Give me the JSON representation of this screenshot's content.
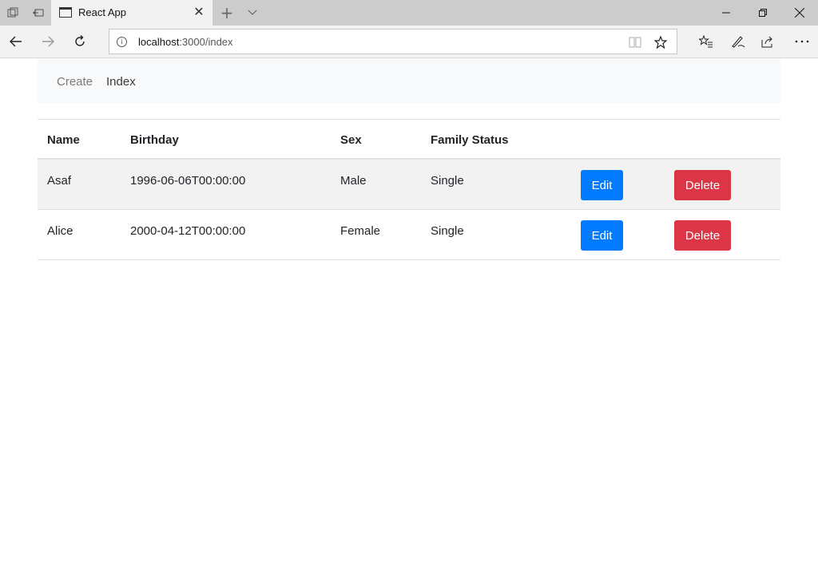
{
  "browser": {
    "tab_title": "React App",
    "url_host": "localhost",
    "url_rest": ":3000/index"
  },
  "nav": {
    "create_label": "Create",
    "index_label": "Index"
  },
  "table": {
    "headers": [
      "Name",
      "Birthday",
      "Sex",
      "Family Status"
    ],
    "rows": [
      {
        "name": "Asaf",
        "birthday": "1996-06-06T00:00:00",
        "sex": "Male",
        "family_status": "Single"
      },
      {
        "name": "Alice",
        "birthday": "2000-04-12T00:00:00",
        "sex": "Female",
        "family_status": "Single"
      }
    ],
    "edit_label": "Edit",
    "delete_label": "Delete"
  },
  "colors": {
    "edit_button": "#007bff",
    "delete_button": "#dc3545"
  }
}
